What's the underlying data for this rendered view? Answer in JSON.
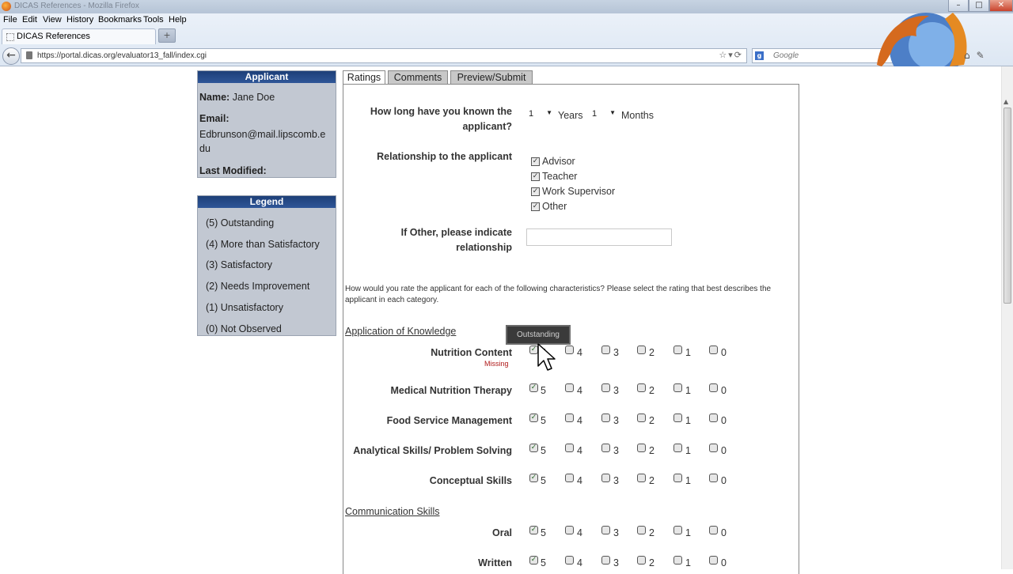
{
  "window": {
    "title": "DICAS References - Mozilla Firefox"
  },
  "menu": [
    "File",
    "Edit",
    "View",
    "History",
    "Bookmarks",
    "Tools",
    "Help"
  ],
  "tab": {
    "label": "DICAS References"
  },
  "url": "https://portal.dicas.org/evaluator13_fall/index.cgi",
  "search": {
    "placeholder": "Google"
  },
  "applicant": {
    "title": "Applicant",
    "name_label": "Name:",
    "name_value": "Jane Doe",
    "email_label": "Email:",
    "email_value_line1": "Edbrunson@mail.lipscomb.e",
    "email_value_line2": "du",
    "modified_label": "Last Modified:"
  },
  "legend": {
    "title": "Legend",
    "items": [
      "(5) Outstanding",
      "(4) More than Satisfactory",
      "(3) Satisfactory",
      "(2) Needs Improvement",
      "(1) Unsatisfactory",
      "(0) Not Observed"
    ]
  },
  "form_tabs": [
    "Ratings",
    "Comments",
    "Preview/Submit"
  ],
  "known": {
    "label_line1": "How long have you known the",
    "label_line2": "applicant?",
    "years_value": "1",
    "years_label": "Years",
    "months_value": "1",
    "months_label": "Months"
  },
  "relationship": {
    "label": "Relationship to the applicant",
    "options": [
      {
        "label": "Advisor",
        "checked": true
      },
      {
        "label": "Teacher",
        "checked": true
      },
      {
        "label": "Work Supervisor",
        "checked": true
      },
      {
        "label": "Other",
        "checked": true
      }
    ]
  },
  "other": {
    "label_line1": "If Other, please indicate",
    "label_line2": "relationship",
    "value": ""
  },
  "instructions_line1": "How would you rate the applicant for each of the following characteristics? Please select the rating that best describes the",
  "instructions_line2": "applicant in each category.",
  "sections": [
    {
      "title": "Application of Knowledge",
      "rows": [
        {
          "label": "Nutrition Content",
          "selected": 5
        },
        {
          "label": "Medical Nutrition Therapy",
          "selected": 5
        },
        {
          "label": "Food Service Management",
          "selected": 5
        },
        {
          "label": "Analytical Skills/ Problem Solving",
          "selected": 5
        },
        {
          "label": "Conceptual Skills",
          "selected": 5
        }
      ]
    },
    {
      "title": "Communication Skills",
      "rows": [
        {
          "label": "Oral",
          "selected": 5
        },
        {
          "label": "Written",
          "selected": 5
        }
      ]
    }
  ],
  "rating_values": [
    "5",
    "4",
    "3",
    "2",
    "1",
    "0"
  ],
  "missing_text": "Missing",
  "tooltip_text": "Outstanding",
  "colors": {
    "panel_header": "#1d3f78",
    "panel_bg": "#c2c8d2",
    "missing": "#b01a1a"
  }
}
